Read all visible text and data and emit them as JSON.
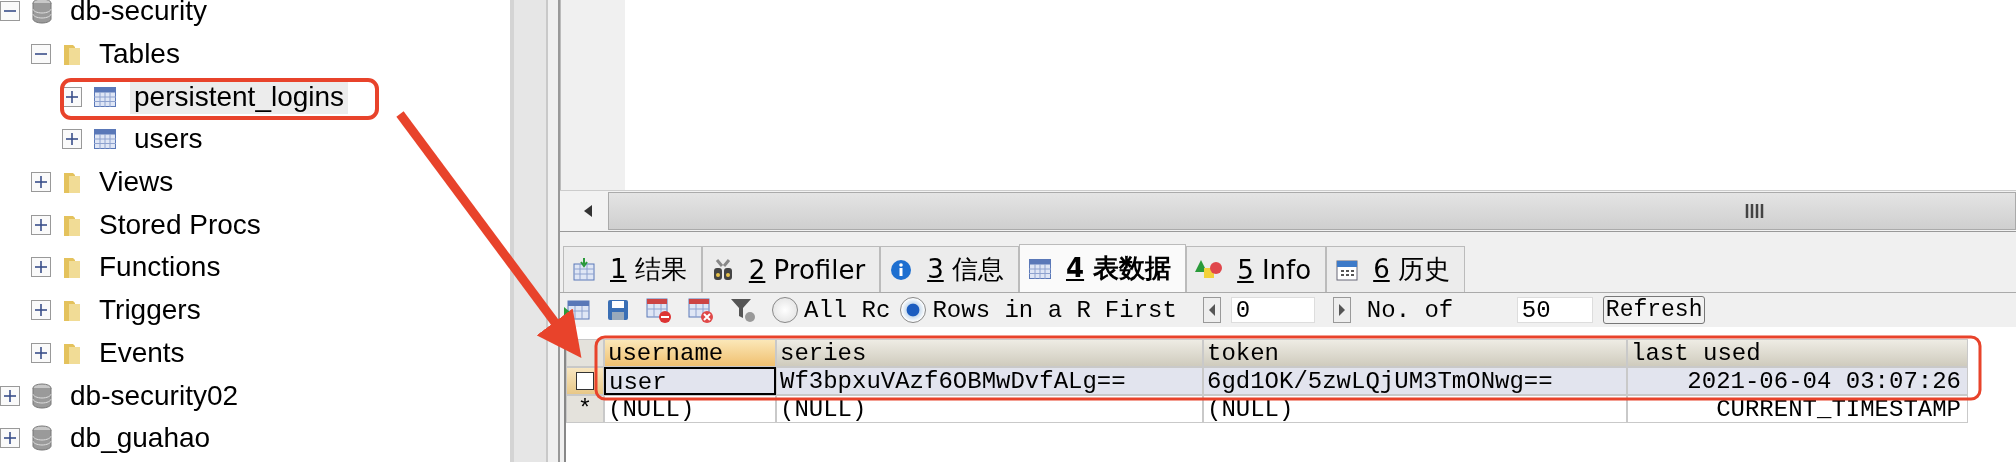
{
  "tree": [
    {
      "label": "db-security",
      "kind": "database",
      "expanded": true,
      "selected": false,
      "children": [
        {
          "label": "Tables",
          "kind": "folder",
          "expanded": true,
          "selected": false,
          "children": [
            {
              "label": "persistent_logins",
              "kind": "table",
              "expanded": false,
              "selected": true
            },
            {
              "label": "users",
              "kind": "table",
              "expanded": false,
              "selected": false
            }
          ]
        },
        {
          "label": "Views",
          "kind": "folder",
          "expanded": false,
          "selected": false
        },
        {
          "label": "Stored Procs",
          "kind": "folder",
          "expanded": false,
          "selected": false
        },
        {
          "label": "Functions",
          "kind": "folder",
          "expanded": false,
          "selected": false
        },
        {
          "label": "Triggers",
          "kind": "folder",
          "expanded": false,
          "selected": false
        },
        {
          "label": "Events",
          "kind": "folder",
          "expanded": false,
          "selected": false
        }
      ]
    },
    {
      "label": "db-security02",
      "kind": "database",
      "expanded": false,
      "selected": false
    },
    {
      "label": "db_guahao",
      "kind": "database",
      "expanded": false,
      "selected": false
    }
  ],
  "tabs": [
    {
      "number": "1",
      "label": "结果",
      "selected": false
    },
    {
      "number": "2",
      "label": "Profiler",
      "selected": false
    },
    {
      "number": "3",
      "label": "信息",
      "selected": false
    },
    {
      "number": "4",
      "label": "表数据",
      "selected": true
    },
    {
      "number": "5",
      "label": "Info",
      "selected": false
    },
    {
      "number": "6",
      "label": "历史",
      "selected": false
    }
  ],
  "toolbar": {
    "modes": [
      {
        "label": "All Rc",
        "selected": false
      },
      {
        "label": "Rows in a R",
        "selected": true
      }
    ],
    "first_label": "First",
    "first_value": "0",
    "count_label": "No. of",
    "count_value": "50",
    "refresh": "Refresh"
  },
  "grid": {
    "columns": [
      {
        "name": "username",
        "selected": true
      },
      {
        "name": "series",
        "selected": false
      },
      {
        "name": "token",
        "selected": false
      },
      {
        "name": "last used",
        "selected": false
      }
    ],
    "rows": [
      {
        "kind": "current",
        "selected": true,
        "cells": [
          "user",
          "Wf3bpxuVAzf6OBMwDvfALg==",
          "6gd1OK/5zwLQjUM3TmONwg==",
          "2021-06-04 03:07:26"
        ]
      },
      {
        "kind": "new",
        "marker": "*",
        "selected": false,
        "cells": [
          "(NULL)",
          "(NULL)",
          "(NULL)",
          "CURRENT_TIMESTAMP"
        ]
      }
    ]
  }
}
